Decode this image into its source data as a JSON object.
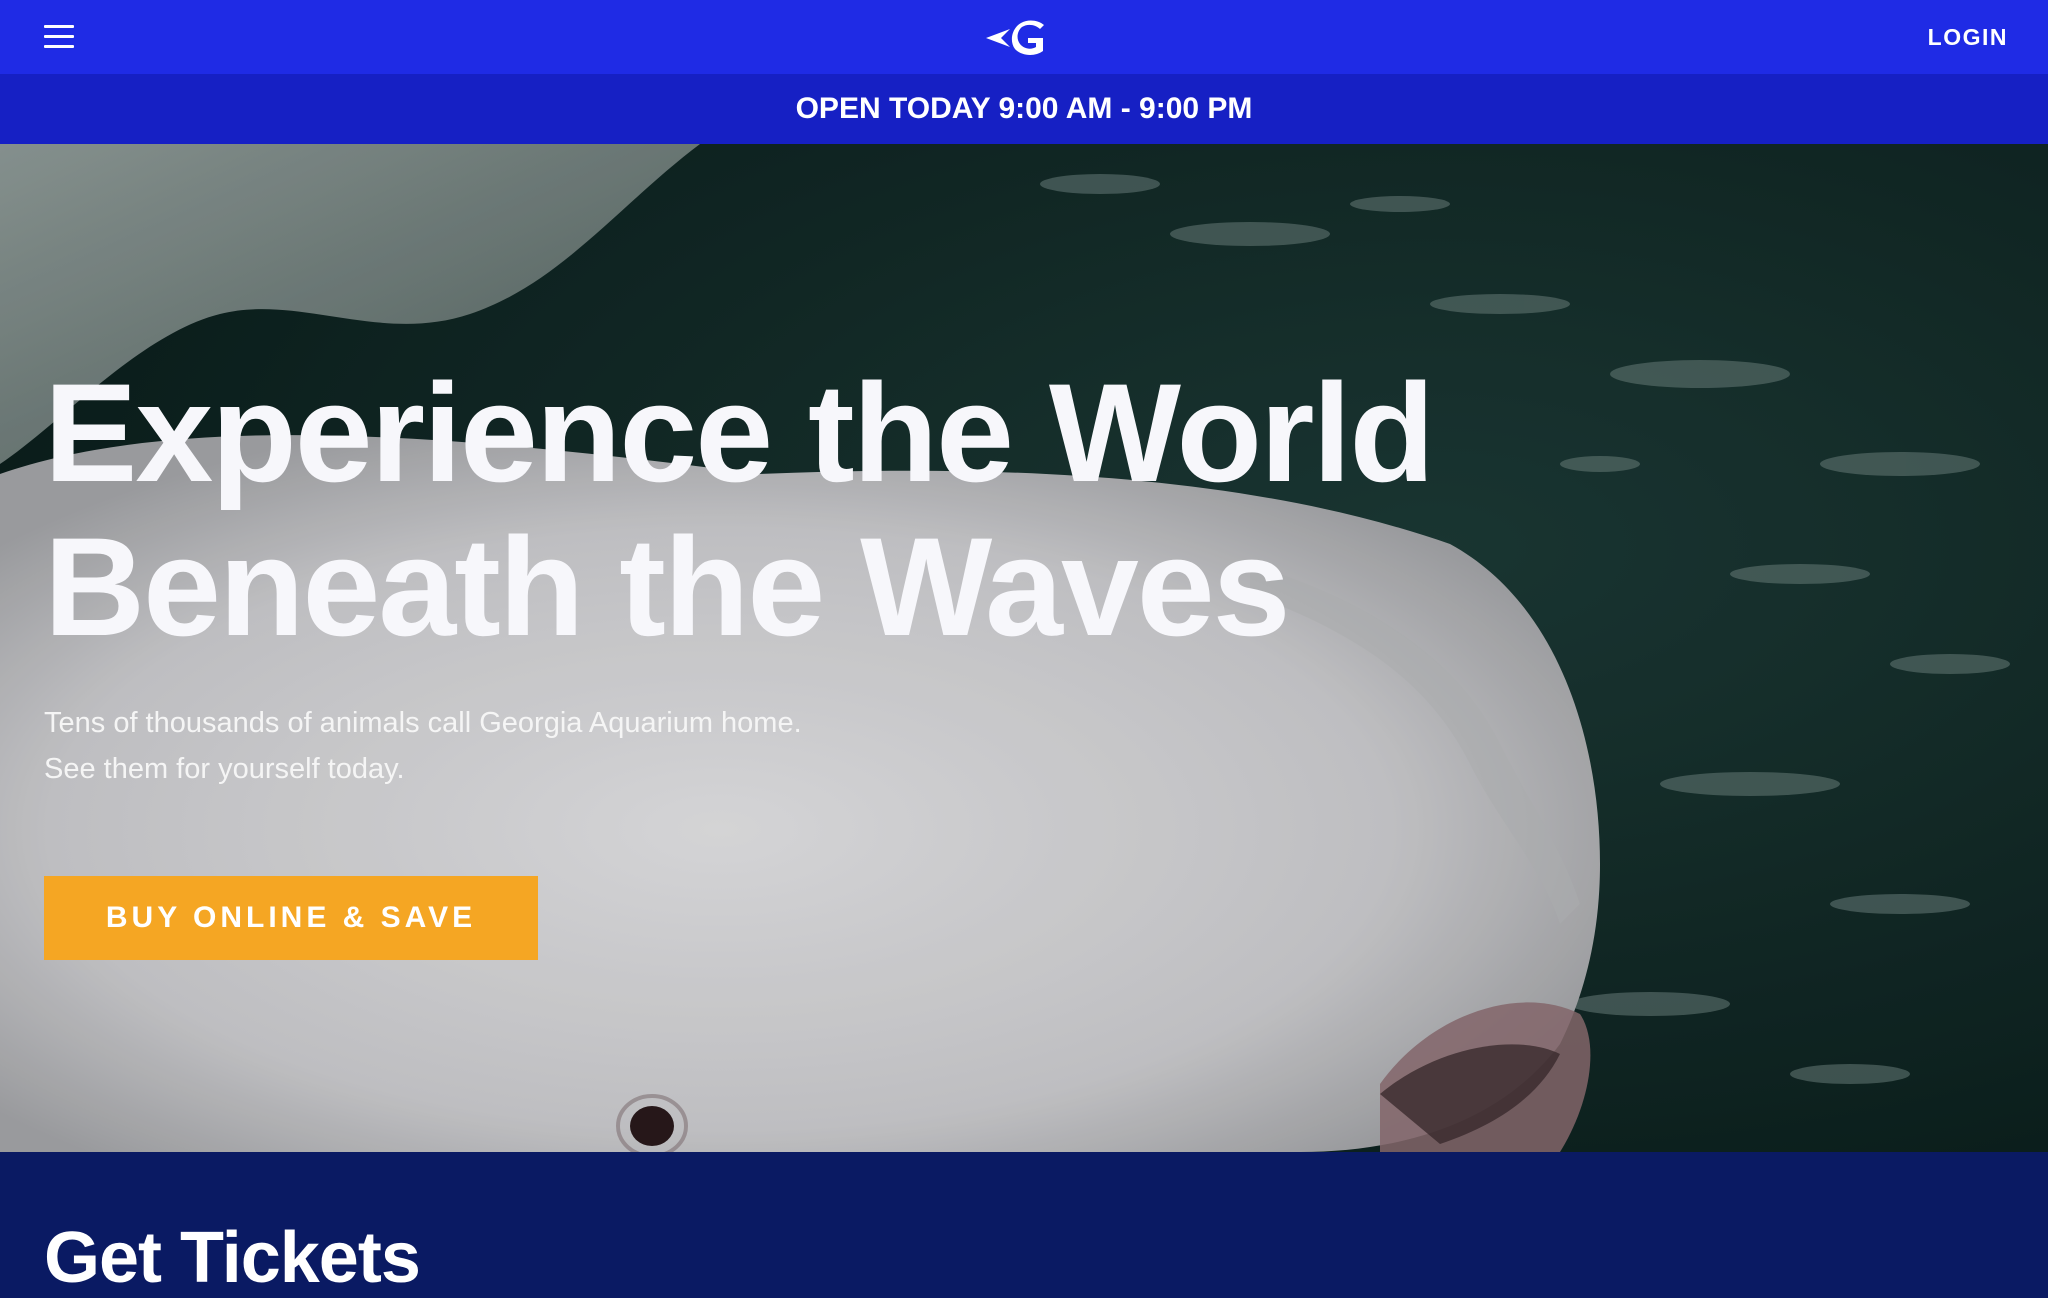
{
  "header": {
    "menu_icon": "hamburger-menu-icon",
    "logo_icon": "georgia-aquarium-g-logo",
    "login_label": "LOGIN"
  },
  "hours_bar": {
    "text": "OPEN TODAY 9:00 AM - 9:00 PM"
  },
  "hero": {
    "title_line1": "Experience the World",
    "title_line2": "Beneath the Waves",
    "subtitle_line1": "Tens of thousands of animals call Georgia Aquarium home.",
    "subtitle_line2": "See them for yourself today.",
    "cta_label": "BUY ONLINE & SAVE",
    "image": "beluga-whale-photo"
  },
  "tickets": {
    "heading": "Get Tickets"
  },
  "colors": {
    "topbar": "#1f2be5",
    "hours_bar": "#1620c4",
    "cta": "#f5a623",
    "tickets_bg": "#0a1a63",
    "text": "#ffffff"
  }
}
